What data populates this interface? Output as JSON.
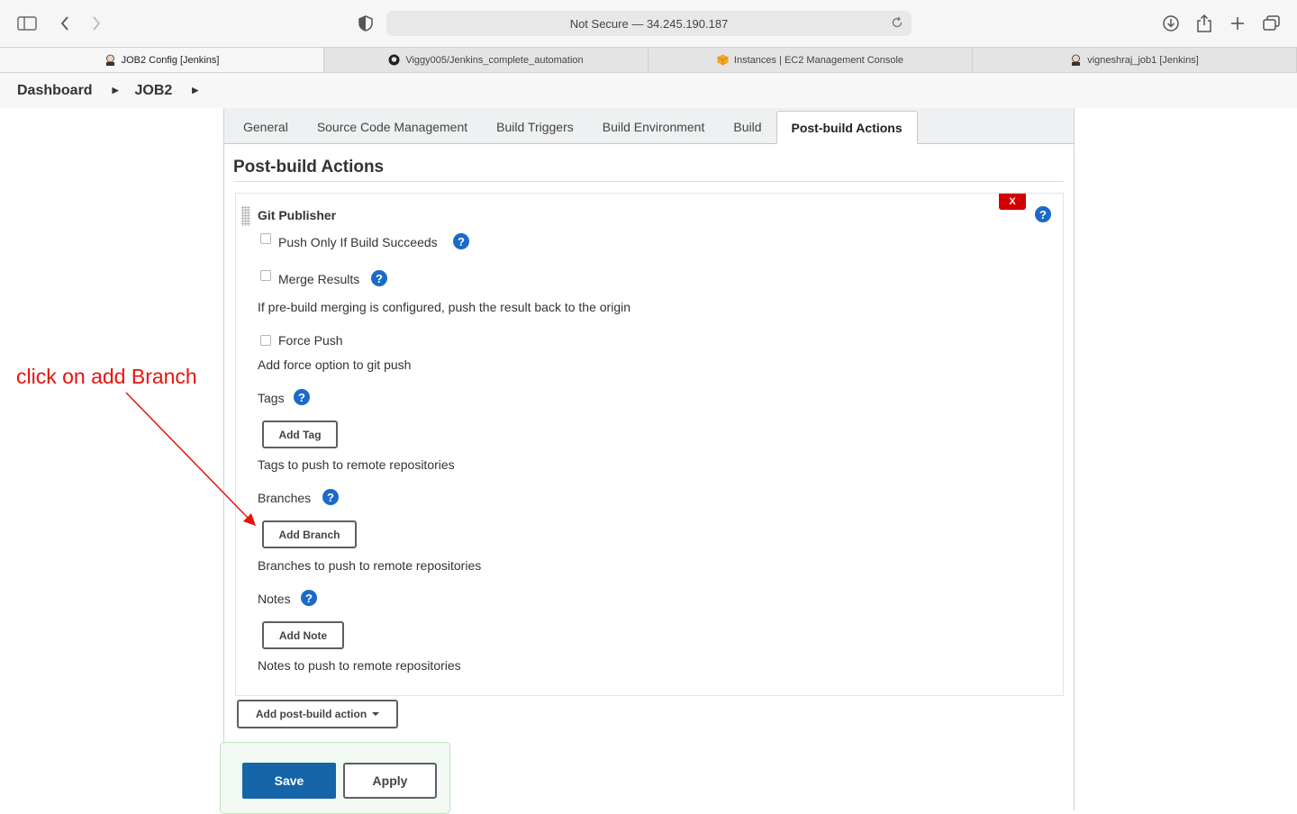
{
  "browser": {
    "url_text": "Not Secure — 34.245.190.187",
    "tabs": [
      {
        "label": "JOB2 Config [Jenkins]",
        "icon": "jenkins-favicon",
        "active": true
      },
      {
        "label": "Viggy005/Jenkins_complete_automation",
        "icon": "github-favicon",
        "active": false
      },
      {
        "label": "Instances | EC2 Management Console",
        "icon": "aws-favicon",
        "active": false
      },
      {
        "label": "vigneshraj_job1 [Jenkins]",
        "icon": "jenkins-favicon",
        "active": false
      }
    ]
  },
  "breadcrumb": {
    "items": [
      "Dashboard",
      "JOB2"
    ]
  },
  "config_tabs": [
    "General",
    "Source Code Management",
    "Build Triggers",
    "Build Environment",
    "Build",
    "Post-build Actions"
  ],
  "active_tab": "Post-build Actions",
  "section": {
    "title": "Post-build Actions"
  },
  "git_publisher": {
    "title": "Git Publisher",
    "delete_label": "X",
    "push_only_label": "Push Only If Build Succeeds",
    "merge_results_label": "Merge Results",
    "merge_desc": "If pre-build merging is configured, push the result back to the origin",
    "force_push_label": "Force Push",
    "force_push_desc": "Add force option to git push",
    "tags_label": "Tags",
    "add_tag_label": "Add Tag",
    "tags_desc": "Tags to push to remote repositories",
    "branches_label": "Branches",
    "add_branch_label": "Add Branch",
    "branches_desc": "Branches to push to remote repositories",
    "notes_label": "Notes",
    "add_note_label": "Add Note",
    "notes_desc": "Notes to push to remote repositories"
  },
  "add_post_build_label": "Add post-build action",
  "buttons": {
    "save": "Save",
    "apply": "Apply"
  },
  "annotation": {
    "text": "click on add Branch",
    "color": "#e8120c"
  },
  "colors": {
    "help": "#1b6ac9",
    "save": "#1565a8",
    "delete": "#d20000"
  }
}
